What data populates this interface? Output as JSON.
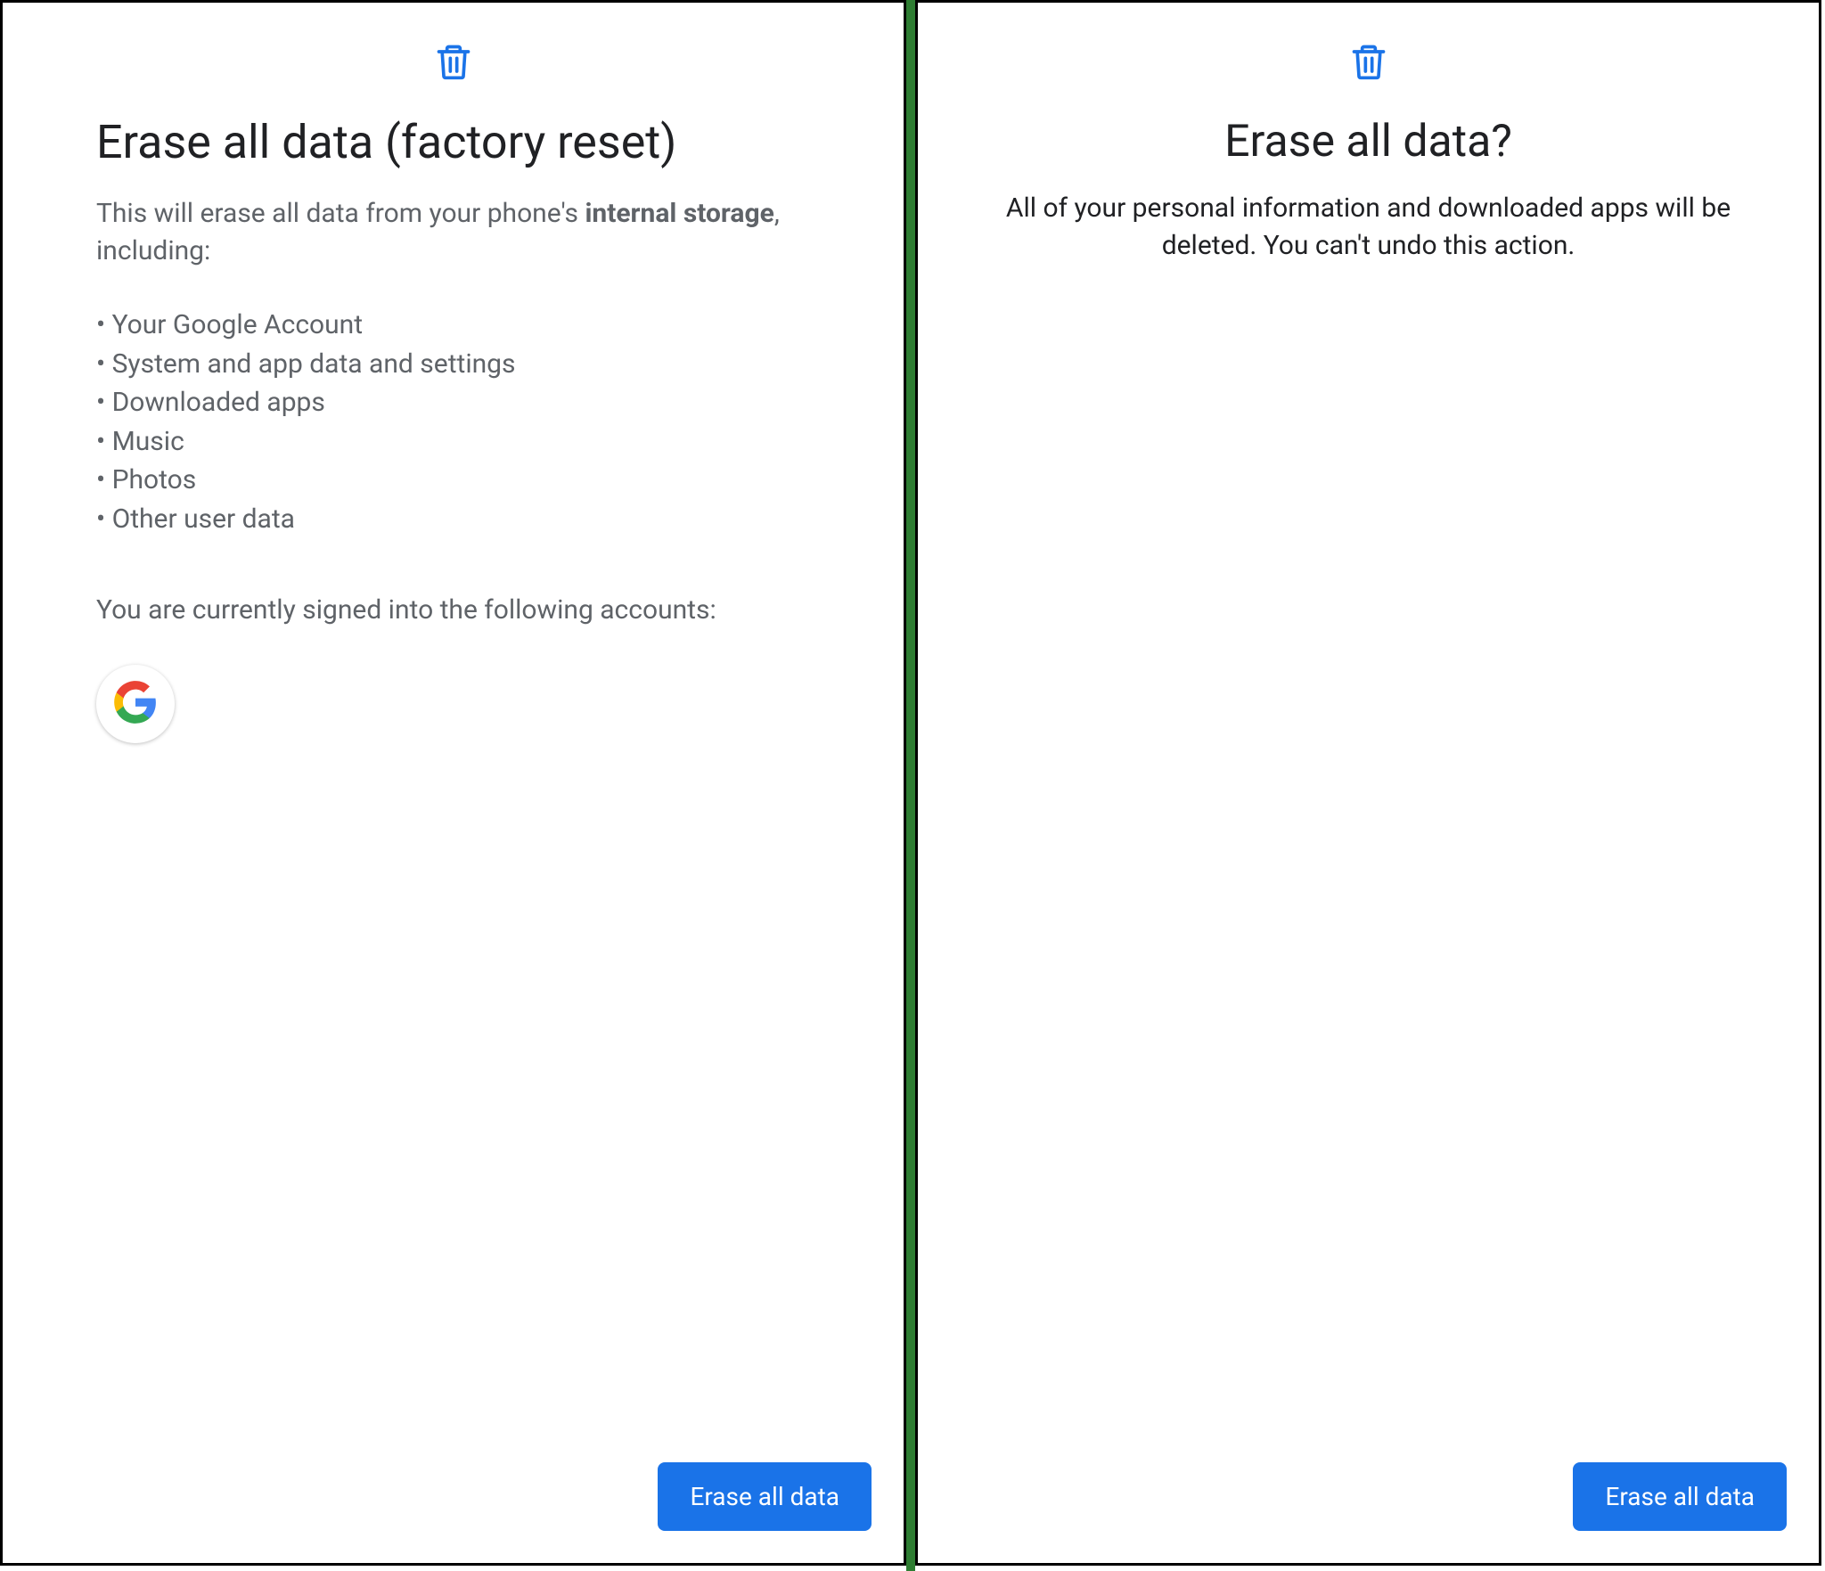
{
  "left": {
    "title": "Erase all data (factory reset)",
    "desc_prefix": "This will erase all data from your phone's ",
    "desc_bold": "internal storage",
    "desc_suffix": ", including:",
    "bullets": [
      "Your Google Account",
      "System and app data and settings",
      "Downloaded apps",
      "Music",
      "Photos",
      "Other user data"
    ],
    "accounts_text": "You are currently signed into the following accounts:",
    "button_label": "Erase all data"
  },
  "right": {
    "title": "Erase all data?",
    "desc": "All of your personal information and downloaded apps will be deleted. You can't undo this action.",
    "button_label": "Erase all data"
  },
  "colors": {
    "accent": "#1a73e8",
    "text_primary": "#202124",
    "text_secondary": "#5f6368",
    "divider": "#2e7d32"
  }
}
